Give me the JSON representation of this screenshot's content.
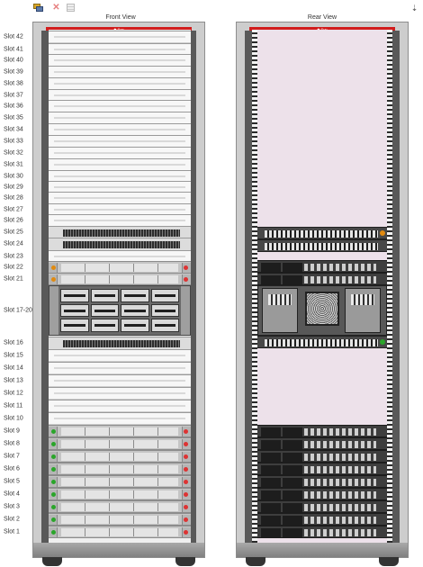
{
  "toolbar": {
    "add_icon": "rack-add-icon",
    "delete_icon": "delete-icon",
    "properties_icon": "properties-icon",
    "menu_icon": "chevron-down-icon"
  },
  "views": {
    "front_title": "Front View",
    "rear_title": "Rear View",
    "rack_logo": "◆ Sun"
  },
  "slots": [
    "Slot 42",
    "Slot 41",
    "Slot 40",
    "Slot 39",
    "Slot 38",
    "Slot 37",
    "Slot 36",
    "Slot 35",
    "Slot 34",
    "Slot 33",
    "Slot 32",
    "Slot 31",
    "Slot 30",
    "Slot 29",
    "Slot 28",
    "Slot 27",
    "Slot 26",
    "Slot 25",
    "Slot 24",
    "Slot 23",
    "Slot 22",
    "Slot 21",
    "Slot 17-20",
    "Slot 16",
    "Slot 15",
    "Slot 14",
    "Slot 13",
    "Slot 12",
    "Slot 11",
    "Slot 10",
    "Slot 9",
    "Slot 8",
    "Slot 7",
    "Slot 6",
    "Slot 5",
    "Slot 4",
    "Slot 3",
    "Slot 2",
    "Slot 1"
  ],
  "colors": {
    "rack_topbar": "#d11d1d",
    "rear_interior": "#ede1ea",
    "led_green": "#2aa52a",
    "led_orange": "#e08a10"
  }
}
